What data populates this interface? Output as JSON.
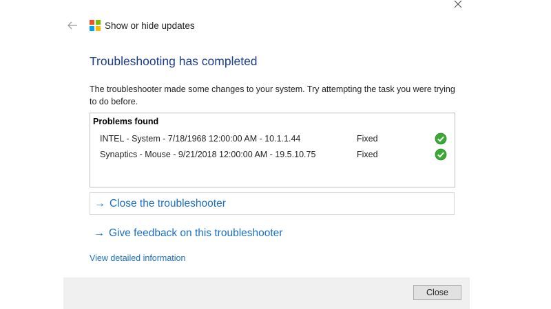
{
  "header": {
    "title": "Show or hide updates"
  },
  "main": {
    "title": "Troubleshooting has completed",
    "description": "The troubleshooter made some changes to your system. Try attempting the task you were trying to do before."
  },
  "problems": {
    "header": "Problems found",
    "items": [
      {
        "name": "INTEL - System - 7/18/1968 12:00:00 AM - 10.1.1.44",
        "status": "Fixed"
      },
      {
        "name": "Synaptics - Mouse - 9/21/2018 12:00:00 AM - 19.5.10.75",
        "status": "Fixed"
      }
    ]
  },
  "actions": {
    "close_troubleshooter": "Close the troubleshooter",
    "give_feedback": "Give feedback on this troubleshooter",
    "view_details": "View detailed information"
  },
  "footer": {
    "close_label": "Close"
  },
  "icons": {
    "close_window": "close-icon",
    "back": "back-arrow-icon",
    "logo": "windows-logo-icon",
    "fixed": "green-check-icon",
    "action_arrow": "arrow-right-icon"
  },
  "colors": {
    "title": "#1c3d8c",
    "link": "#1a6fc4",
    "check": "#3aa935",
    "footer_bg": "#f0f0f0",
    "logo_red": "#f25022",
    "logo_green": "#7fba00",
    "logo_blue": "#00a4ef",
    "logo_yellow": "#ffb900"
  }
}
